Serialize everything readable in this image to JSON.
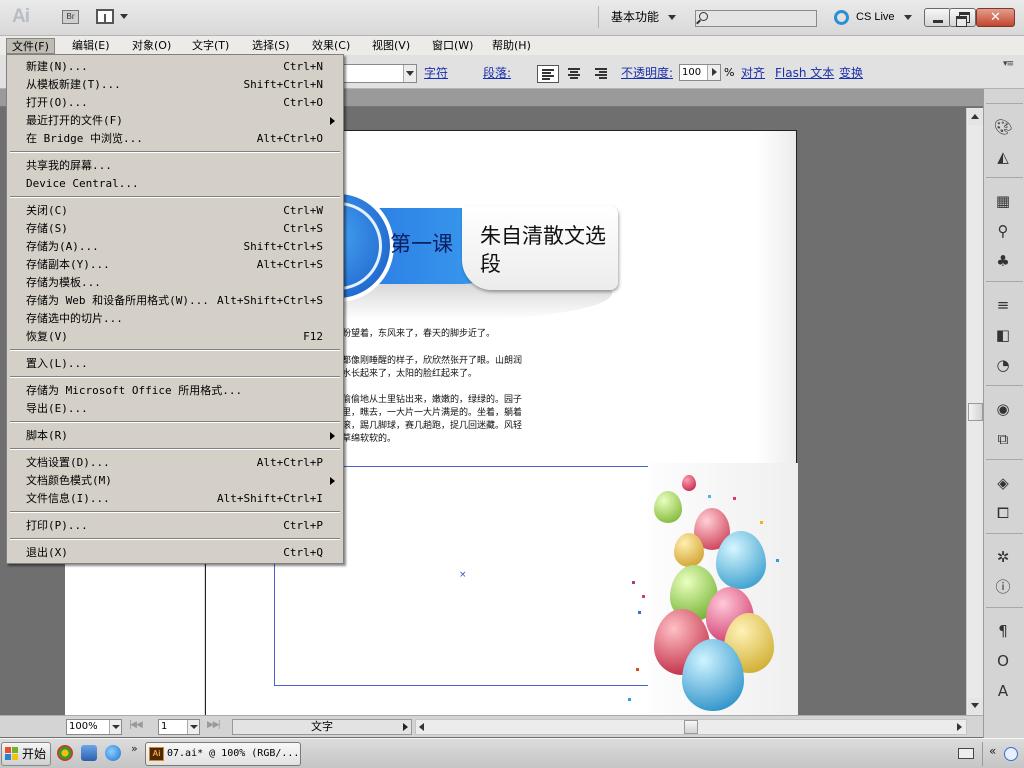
{
  "app": {
    "logo": "Ai",
    "bridge_label": "Br",
    "workspace": "基本功能",
    "cs_live": "CS Live"
  },
  "menubar": [
    {
      "label": "文件(F)"
    },
    {
      "label": "编辑(E)"
    },
    {
      "label": "对象(O)"
    },
    {
      "label": "文字(T)"
    },
    {
      "label": "选择(S)"
    },
    {
      "label": "效果(C)"
    },
    {
      "label": "视图(V)"
    },
    {
      "label": "窗口(W)"
    },
    {
      "label": "帮助(H)"
    }
  ],
  "controlbar": {
    "char_label": "字符",
    "para_label": "段落:",
    "opacity_label": "不透明度:",
    "opacity_value": "100",
    "percent": "%",
    "align_label": "对齐",
    "flash_label": "Flash 文本",
    "transform_label": "变换"
  },
  "file_menu": {
    "items": [
      {
        "label": "新建(N)...",
        "shortcut": "Ctrl+N"
      },
      {
        "label": "从模板新建(T)...",
        "shortcut": "Shift+Ctrl+N"
      },
      {
        "label": "打开(O)...",
        "shortcut": "Ctrl+O"
      },
      {
        "label": "最近打开的文件(F)",
        "shortcut": ""
      },
      {
        "label": "在 Bridge 中浏览...",
        "shortcut": "Alt+Ctrl+O"
      },
      {
        "label": "共享我的屏幕...",
        "shortcut": ""
      },
      {
        "label": "Device Central...",
        "shortcut": ""
      },
      {
        "label": "关闭(C)",
        "shortcut": "Ctrl+W"
      },
      {
        "label": "存储(S)",
        "shortcut": "Ctrl+S"
      },
      {
        "label": "存储为(A)...",
        "shortcut": "Shift+Ctrl+S"
      },
      {
        "label": "存储副本(Y)...",
        "shortcut": "Alt+Ctrl+S"
      },
      {
        "label": "存储为模板...",
        "shortcut": ""
      },
      {
        "label": "存储为 Web 和设备所用格式(W)...",
        "shortcut": "Alt+Shift+Ctrl+S"
      },
      {
        "label": "存储选中的切片...",
        "shortcut": ""
      },
      {
        "label": "恢复(V)",
        "shortcut": "F12"
      },
      {
        "label": "置入(L)...",
        "shortcut": ""
      },
      {
        "label": "存储为 Microsoft Office 所用格式...",
        "shortcut": ""
      },
      {
        "label": "导出(E)...",
        "shortcut": ""
      },
      {
        "label": "脚本(R)",
        "shortcut": ""
      },
      {
        "label": "文档设置(D)...",
        "shortcut": "Alt+Ctrl+P"
      },
      {
        "label": "文档颜色模式(M)",
        "shortcut": ""
      },
      {
        "label": "文件信息(I)...",
        "shortcut": "Alt+Shift+Ctrl+I"
      },
      {
        "label": "打印(P)...",
        "shortcut": "Ctrl+P"
      },
      {
        "label": "退出(X)",
        "shortcut": "Ctrl+Q"
      }
    ]
  },
  "document": {
    "lesson_number": "第一课",
    "lesson_title": "朱自清散文选段",
    "paragraphs": [
      "盼望着，东风来了，春天的脚步近了。",
      "都像刚睡醒的样子，欣欣然张开了眼。山朗润",
      "水长起来了，太阳的脸红起来了。",
      "偷偷地从土里钻出来，嫩嫩的，绿绿的。园子",
      "里，瞧去，一大片一大片满是的。坐着，躺着",
      "滚，踢几脚球，赛几趟跑，捉几回迷藏。风轻",
      "草绵软软的。"
    ]
  },
  "statusbar": {
    "zoom": "100%",
    "page": "1",
    "info": "文字"
  },
  "taskbar": {
    "start_label": "开始",
    "task_label": "07.ai* @ 100% (RGB/..."
  },
  "colors": {
    "accent_blue": "#2a78e0",
    "title_navy": "#0e1e63",
    "link_blue": "#1a2faa"
  }
}
